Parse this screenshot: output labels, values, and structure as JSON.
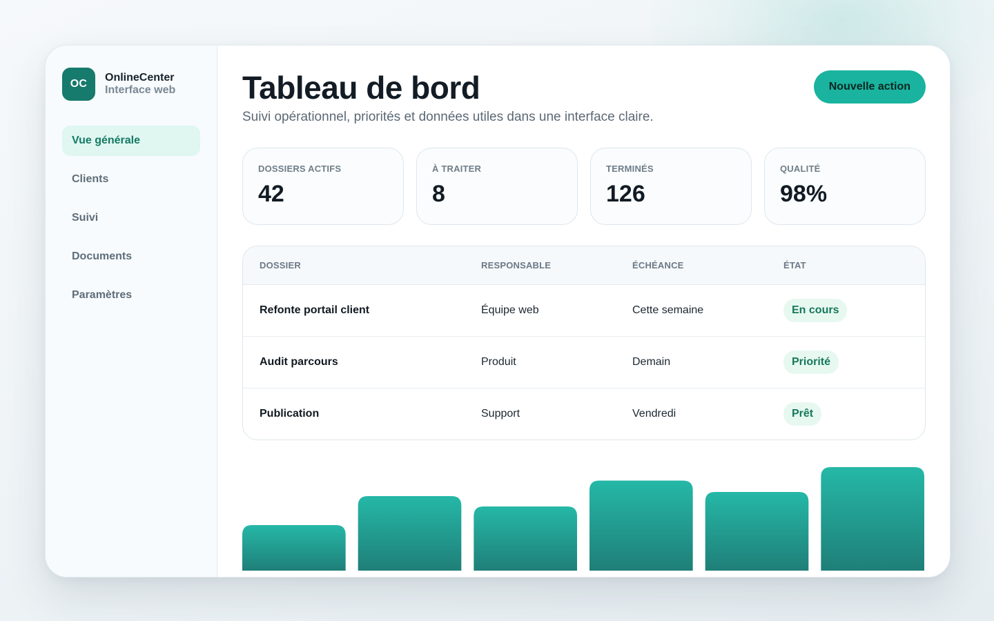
{
  "brand": {
    "logo": "OC",
    "name": "OnlineCenter",
    "subtitle": "Interface web"
  },
  "sidebar": {
    "items": [
      {
        "label": "Vue générale",
        "active": true
      },
      {
        "label": "Clients",
        "active": false
      },
      {
        "label": "Suivi",
        "active": false
      },
      {
        "label": "Documents",
        "active": false
      },
      {
        "label": "Paramètres",
        "active": false
      }
    ]
  },
  "header": {
    "title": "Tableau de bord",
    "subtitle": "Suivi opérationnel, priorités et données utiles dans une interface claire.",
    "action_label": "Nouvelle action"
  },
  "stats": [
    {
      "label": "DOSSIERS ACTIFS",
      "value": "42"
    },
    {
      "label": "À TRAITER",
      "value": "8"
    },
    {
      "label": "TERMINÉS",
      "value": "126"
    },
    {
      "label": "QUALITÉ",
      "value": "98%"
    }
  ],
  "table": {
    "headers": [
      "DOSSIER",
      "RESPONSABLE",
      "ÉCHÉANCE",
      "ÉTAT"
    ],
    "rows": [
      {
        "dossier": "Refonte portail client",
        "responsable": "Équipe web",
        "echeance": "Cette semaine",
        "etat": "En cours"
      },
      {
        "dossier": "Audit parcours",
        "responsable": "Produit",
        "echeance": "Demain",
        "etat": "Priorité"
      },
      {
        "dossier": "Publication",
        "responsable": "Support",
        "echeance": "Vendredi",
        "etat": "Prêt"
      }
    ]
  },
  "colors": {
    "accent": "#1ab39f",
    "brand_dark": "#167a6c",
    "active_nav_bg": "#dff6f1",
    "badge_bg": "#e7f8f1",
    "badge_text": "#16785a",
    "bar_top": "#25b8a7",
    "bar_bottom": "#1f7f78"
  },
  "chart_data": {
    "type": "bar",
    "categories": [
      "",
      "",
      "",
      "",
      "",
      ""
    ],
    "values": [
      44,
      72,
      62,
      87,
      76,
      100
    ],
    "ylim": [
      0,
      100
    ],
    "title": "",
    "xlabel": "",
    "ylabel": "",
    "grid": false
  }
}
